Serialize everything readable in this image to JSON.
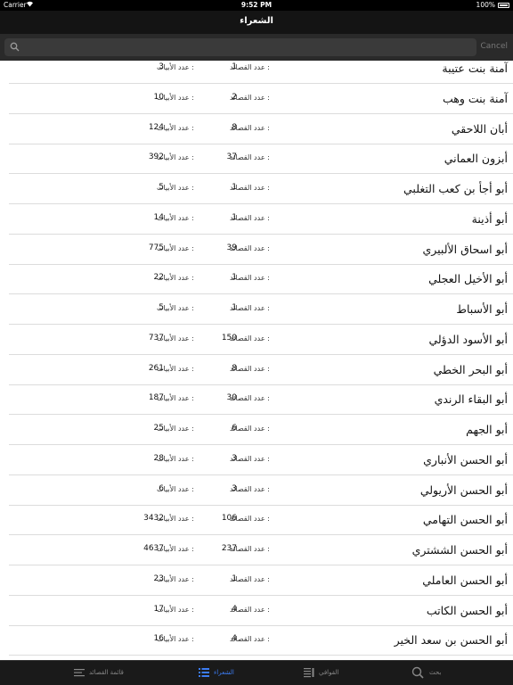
{
  "status_bar": {
    "carrier": "Carrier",
    "time": "9:52 PM",
    "battery": "100%"
  },
  "nav": {
    "title": "الشعراء"
  },
  "search": {
    "placeholder": "",
    "cancel_label": "Cancel"
  },
  "list": {
    "poems_label": "عدد القصائد :",
    "verses_label": "عدد الأبيات :",
    "rows": [
      {
        "name": "آمنة بنت عتيبة",
        "poems": "1",
        "verses": "3"
      },
      {
        "name": "آمنة بنت وهب",
        "poems": "2",
        "verses": "10"
      },
      {
        "name": "أبان اللاحقي",
        "poems": "8",
        "verses": "124"
      },
      {
        "name": "أبزون العماني",
        "poems": "37",
        "verses": "392"
      },
      {
        "name": "أبو أجأ بن كعب التغلبي",
        "poems": "1",
        "verses": "5"
      },
      {
        "name": "أبو أذينة",
        "poems": "1",
        "verses": "14"
      },
      {
        "name": "أبو اسحاق الألبيري",
        "poems": "39",
        "verses": "775"
      },
      {
        "name": "أبو الأخيل العجلي",
        "poems": "1",
        "verses": "22"
      },
      {
        "name": "أبو الأسباط",
        "poems": "1",
        "verses": "5"
      },
      {
        "name": "أبو الأسود الدؤلي",
        "poems": "150",
        "verses": "737"
      },
      {
        "name": "أبو البحر الخطي",
        "poems": "8",
        "verses": "261"
      },
      {
        "name": "أبو البقاء الرندي",
        "poems": "30",
        "verses": "187"
      },
      {
        "name": "أبو الجهم",
        "poems": "6",
        "verses": "25"
      },
      {
        "name": "أبو الحسن الأنباري",
        "poems": "3",
        "verses": "28"
      },
      {
        "name": "أبو الحسن الأريولي",
        "poems": "3",
        "verses": "6"
      },
      {
        "name": "أبو الحسن التهامي",
        "poems": "106",
        "verses": "3432"
      },
      {
        "name": "أبو الحسن الششتري",
        "poems": "237",
        "verses": "4637"
      },
      {
        "name": "أبو الحسن العاملي",
        "poems": "1",
        "verses": "23"
      },
      {
        "name": "أبو الحسن الكاتب",
        "poems": "4",
        "verses": "17"
      },
      {
        "name": "أبو الحسن بن سعد الخير",
        "poems": "4",
        "verses": "16"
      }
    ]
  },
  "tabs": [
    {
      "label": "قائمة القصائد",
      "icon": "list-icon",
      "active": false
    },
    {
      "label": "الشعراء",
      "icon": "poets-list-icon",
      "active": true
    },
    {
      "label": "القوافي",
      "icon": "rhymes-icon",
      "active": false
    },
    {
      "label": "بحث",
      "icon": "search-icon",
      "active": false
    }
  ],
  "colors": {
    "accent": "#3c7cf2",
    "bar_bg": "#141414"
  }
}
